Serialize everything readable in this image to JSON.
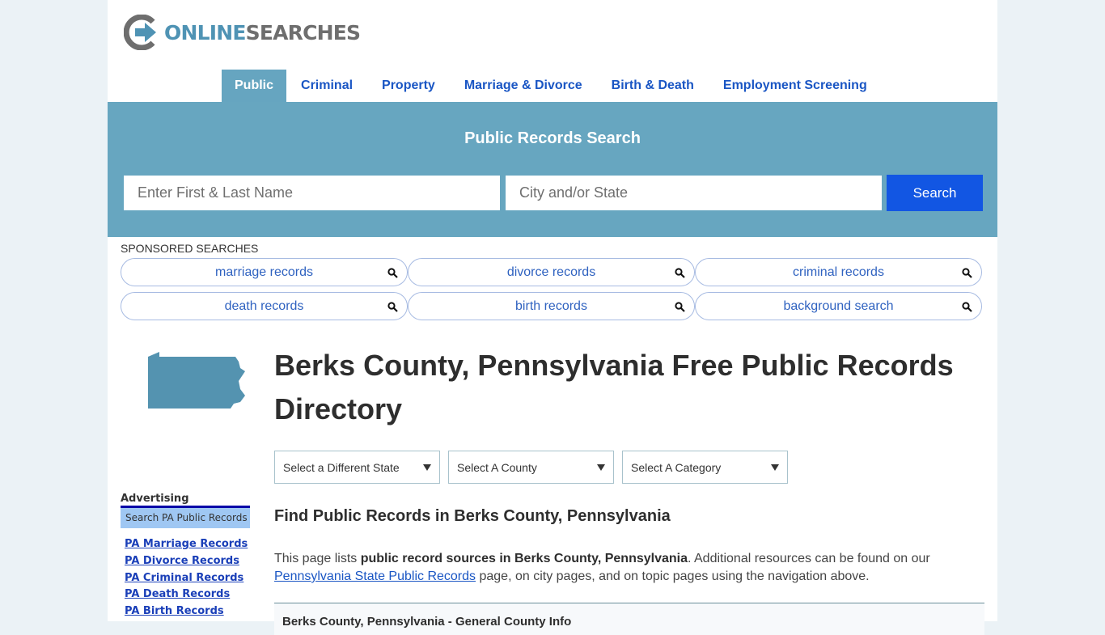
{
  "brand": {
    "online": "ONLINE",
    "searches": "SEARCHES",
    "colors": {
      "online": "#4f93b4",
      "searches": "#6e6e6e",
      "accent": "#67a6c0",
      "button": "#1256e3",
      "link": "#1a56c4"
    }
  },
  "nav": {
    "items": [
      {
        "label": "Public",
        "active": true
      },
      {
        "label": "Criminal",
        "active": false
      },
      {
        "label": "Property",
        "active": false
      },
      {
        "label": "Marriage & Divorce",
        "active": false
      },
      {
        "label": "Birth & Death",
        "active": false
      },
      {
        "label": "Employment Screening",
        "active": false
      }
    ]
  },
  "hero": {
    "title": "Public Records Search",
    "name_placeholder": "Enter First & Last Name",
    "name_value": "",
    "city_placeholder": "City and/or State",
    "city_value": "",
    "search_label": "Search"
  },
  "sponsored": {
    "label": "SPONSORED SEARCHES",
    "items": [
      {
        "label": "marriage records",
        "icon": "search-icon"
      },
      {
        "label": "divorce records",
        "icon": "search-icon"
      },
      {
        "label": "criminal records",
        "icon": "search-icon"
      },
      {
        "label": "death records",
        "icon": "search-icon"
      },
      {
        "label": "birth records",
        "icon": "search-icon"
      },
      {
        "label": "background search",
        "icon": "search-icon"
      }
    ]
  },
  "main": {
    "state_icon": "pennsylvania-map-icon",
    "title": "Berks County, Pennsylvania Free Public Records Directory",
    "selects": [
      {
        "selected": "Select a Different State"
      },
      {
        "selected": "Select A County"
      },
      {
        "selected": "Select A Category"
      }
    ],
    "subtitle": "Find Public Records in Berks County, Pennsylvania",
    "intro": {
      "prefix": "This page lists ",
      "bold": "public record sources in Berks County, Pennsylvania",
      "middle": ". Additional resources can be found on our ",
      "link": "Pennsylvania State Public Records",
      "suffix": " page, on city pages, and on topic pages using the navigation above."
    },
    "info_box_title": "Berks County, Pennsylvania - General County Info"
  },
  "sidebar": {
    "advertising_label": "Advertising",
    "search_bar_label": "Search PA Public Records",
    "links": [
      "PA Marriage Records",
      "PA Divorce Records",
      "PA Criminal Records",
      "PA Death Records",
      "PA Birth Records"
    ]
  }
}
